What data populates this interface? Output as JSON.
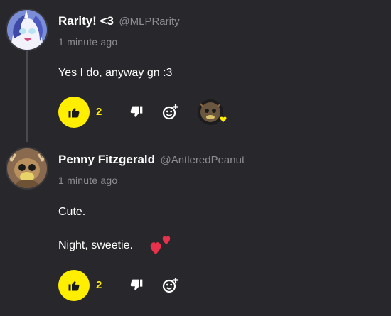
{
  "posts": [
    {
      "display_name": "Rarity! <3",
      "handle": "@MLPRarity",
      "time": "1 minute ago",
      "lines": [
        "Yes I do, anyway gn :3"
      ],
      "like_count": "2",
      "avatar_icon": "unicorn-avatar-icon",
      "reaction_icon": "heart-reaction-icon"
    },
    {
      "display_name": "Penny Fitzgerald",
      "handle": "@AntleredPeanut",
      "time": "1 minute ago",
      "lines": [
        "Cute.",
        "Night, sweetie."
      ],
      "like_count": "2",
      "avatar_icon": "deer-avatar-icon",
      "emoji_icon": "two-hearts-icon"
    }
  ],
  "colors": {
    "background": "#28272b",
    "accent": "#ffee00",
    "muted": "#8e8d93",
    "heart": "#e8314c"
  }
}
